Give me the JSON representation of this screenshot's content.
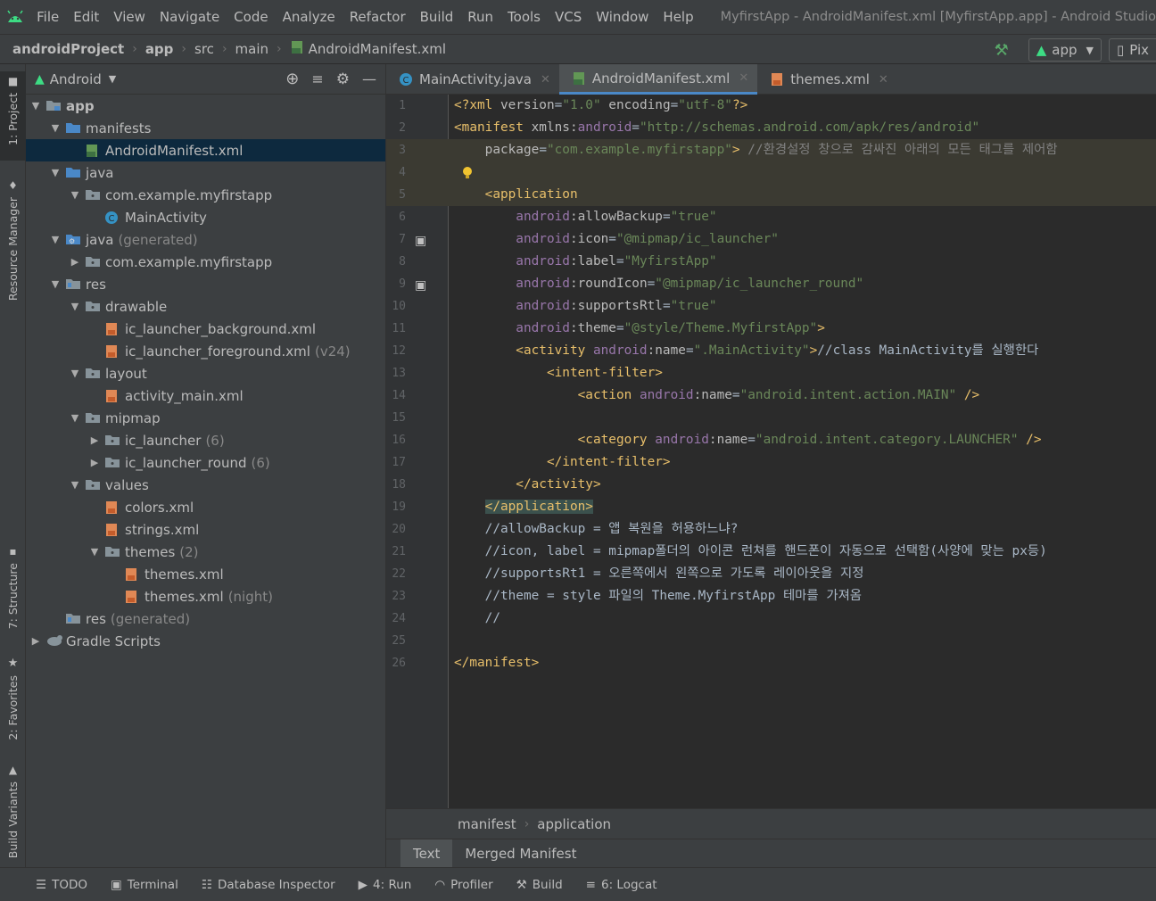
{
  "menubar": {
    "items": [
      "File",
      "Edit",
      "View",
      "Navigate",
      "Code",
      "Analyze",
      "Refactor",
      "Build",
      "Run",
      "Tools",
      "VCS",
      "Window",
      "Help"
    ],
    "window_title": "MyfirstApp - AndroidManifest.xml [MyfirstApp.app] - Android Studio"
  },
  "navbar": {
    "crumbs": [
      "androidProject",
      "app",
      "src",
      "main",
      "AndroidManifest.xml"
    ],
    "run_config": "app",
    "device": "Pix"
  },
  "side_tabs": {
    "project": "1: Project",
    "resource_manager": "Resource Manager",
    "structure": "7: Structure",
    "favorites": "2: Favorites",
    "build_variants": "Build Variants"
  },
  "project_panel": {
    "view_mode": "Android",
    "tree": [
      {
        "label": "app",
        "bold": true,
        "icon": "module-folder-icon",
        "arrow": "open",
        "depth": 0
      },
      {
        "label": "manifests",
        "icon": "folder-icon",
        "arrow": "open",
        "depth": 1
      },
      {
        "label": "AndroidManifest.xml",
        "icon": "manifest-file-icon",
        "arrow": "none",
        "depth": 2,
        "selected": true
      },
      {
        "label": "java",
        "icon": "folder-icon",
        "arrow": "open",
        "depth": 1
      },
      {
        "label": "com.example.myfirstapp",
        "icon": "package-icon",
        "arrow": "open",
        "depth": 2
      },
      {
        "label": "MainActivity",
        "icon": "class-icon",
        "arrow": "none",
        "depth": 3
      },
      {
        "label": "java",
        "suffix": "(generated)",
        "icon": "generated-folder-icon",
        "arrow": "open",
        "depth": 1
      },
      {
        "label": "com.example.myfirstapp",
        "icon": "package-icon",
        "arrow": "closed",
        "depth": 2
      },
      {
        "label": "res",
        "icon": "res-folder-icon",
        "arrow": "open",
        "depth": 1
      },
      {
        "label": "drawable",
        "icon": "package-icon",
        "arrow": "open",
        "depth": 2
      },
      {
        "label": "ic_launcher_background.xml",
        "icon": "xml-file-icon",
        "arrow": "none",
        "depth": 3
      },
      {
        "label": "ic_launcher_foreground.xml",
        "suffix": "(v24)",
        "icon": "xml-file-icon",
        "arrow": "none",
        "depth": 3
      },
      {
        "label": "layout",
        "icon": "package-icon",
        "arrow": "open",
        "depth": 2
      },
      {
        "label": "activity_main.xml",
        "icon": "xml-file-icon",
        "arrow": "none",
        "depth": 3
      },
      {
        "label": "mipmap",
        "icon": "package-icon",
        "arrow": "open",
        "depth": 2
      },
      {
        "label": "ic_launcher",
        "suffix": "(6)",
        "icon": "package-icon",
        "arrow": "closed",
        "depth": 3
      },
      {
        "label": "ic_launcher_round",
        "suffix": "(6)",
        "icon": "package-icon",
        "arrow": "closed",
        "depth": 3
      },
      {
        "label": "values",
        "icon": "package-icon",
        "arrow": "open",
        "depth": 2
      },
      {
        "label": "colors.xml",
        "icon": "xml-file-icon",
        "arrow": "none",
        "depth": 3
      },
      {
        "label": "strings.xml",
        "icon": "xml-file-icon",
        "arrow": "none",
        "depth": 3
      },
      {
        "label": "themes",
        "suffix": "(2)",
        "icon": "package-icon",
        "arrow": "open",
        "depth": 3
      },
      {
        "label": "themes.xml",
        "icon": "xml-file-icon",
        "arrow": "none",
        "depth": 4
      },
      {
        "label": "themes.xml",
        "suffix": "(night)",
        "icon": "xml-file-icon",
        "arrow": "none",
        "depth": 4
      },
      {
        "label": "res",
        "suffix": "(generated)",
        "icon": "res-folder-icon",
        "arrow": "none",
        "depth": 1
      },
      {
        "label": "Gradle Scripts",
        "icon": "gradle-icon",
        "arrow": "closed",
        "depth": 0
      }
    ]
  },
  "editor_tabs": [
    {
      "label": "MainActivity.java",
      "icon": "class-icon"
    },
    {
      "label": "AndroidManifest.xml",
      "icon": "manifest-file-icon",
      "active": true
    },
    {
      "label": "themes.xml",
      "icon": "xml-file-icon"
    }
  ],
  "code_lines": [
    [
      [
        "t",
        "<?xml "
      ],
      [
        "a",
        "version"
      ],
      [
        "p",
        "="
      ],
      [
        "s",
        "\"1.0\""
      ],
      [
        "a",
        " encoding"
      ],
      [
        "p",
        "="
      ],
      [
        "s",
        "\"utf-8\""
      ],
      [
        "t",
        "?>"
      ]
    ],
    [
      [
        "t",
        "<manifest "
      ],
      [
        "a",
        "xmlns:"
      ],
      [
        "ns",
        "android"
      ],
      [
        "p",
        "="
      ],
      [
        "s",
        "\"http://schemas.android.com/apk/res/android\""
      ]
    ],
    [
      [
        "a",
        "    package"
      ],
      [
        "p",
        "="
      ],
      [
        "s",
        "\"com.example.myfirstapp\""
      ],
      [
        "t",
        ">"
      ],
      [
        "c",
        " //환경설정 창으로 감싸진 아래의 모든 태그를 제어함"
      ]
    ],
    [
      [
        "p",
        ""
      ]
    ],
    [
      [
        "t",
        "    <application"
      ]
    ],
    [
      [
        "ns",
        "        android"
      ],
      [
        "a",
        ":allowBackup"
      ],
      [
        "p",
        "="
      ],
      [
        "s",
        "\"true\""
      ]
    ],
    [
      [
        "ns",
        "        android"
      ],
      [
        "a",
        ":icon"
      ],
      [
        "p",
        "="
      ],
      [
        "s",
        "\"@mipmap/ic_launcher\""
      ]
    ],
    [
      [
        "ns",
        "        android"
      ],
      [
        "a",
        ":label"
      ],
      [
        "p",
        "="
      ],
      [
        "s",
        "\"MyfirstApp\""
      ]
    ],
    [
      [
        "ns",
        "        android"
      ],
      [
        "a",
        ":roundIcon"
      ],
      [
        "p",
        "="
      ],
      [
        "s",
        "\"@mipmap/ic_launcher_round\""
      ]
    ],
    [
      [
        "ns",
        "        android"
      ],
      [
        "a",
        ":supportsRtl"
      ],
      [
        "p",
        "="
      ],
      [
        "s",
        "\"true\""
      ]
    ],
    [
      [
        "ns",
        "        android"
      ],
      [
        "a",
        ":theme"
      ],
      [
        "p",
        "="
      ],
      [
        "s",
        "\"@style/Theme.MyfirstApp\""
      ],
      [
        "t",
        ">"
      ]
    ],
    [
      [
        "t",
        "        <activity "
      ],
      [
        "ns",
        "android"
      ],
      [
        "a",
        ":name"
      ],
      [
        "p",
        "="
      ],
      [
        "s",
        "\".MainActivity\""
      ],
      [
        "t",
        ">"
      ],
      [
        "p",
        "//class MainActivity를 실행한다"
      ]
    ],
    [
      [
        "t",
        "            <intent-filter>"
      ]
    ],
    [
      [
        "t",
        "                <action "
      ],
      [
        "ns",
        "android"
      ],
      [
        "a",
        ":name"
      ],
      [
        "p",
        "="
      ],
      [
        "s",
        "\"android.intent.action.MAIN\""
      ],
      [
        "t",
        " />"
      ]
    ],
    [
      [
        "p",
        ""
      ]
    ],
    [
      [
        "t",
        "                <category "
      ],
      [
        "ns",
        "android"
      ],
      [
        "a",
        ":name"
      ],
      [
        "p",
        "="
      ],
      [
        "s",
        "\"android.intent.category.LAUNCHER\""
      ],
      [
        "t",
        " />"
      ]
    ],
    [
      [
        "t",
        "            </intent-filter>"
      ]
    ],
    [
      [
        "t",
        "        </activity>"
      ]
    ],
    [
      [
        "p",
        "    "
      ],
      [
        "t",
        "</application>"
      ]
    ],
    [
      [
        "p",
        "    //allowBackup = 앱 복원을 허용하느냐?"
      ]
    ],
    [
      [
        "p",
        "    //icon, label = mipmap폴더의 아이콘 런쳐를 핸드폰이 자동으로 선택함(사양에 맞는 px등)"
      ]
    ],
    [
      [
        "p",
        "    //supportsRt1 = 오른쪽에서 왼쪽으로 가도록 레이아웃을 지정"
      ]
    ],
    [
      [
        "p",
        "    //theme = style 파일의 Theme.MyfirstApp 테마를 가져옴"
      ]
    ],
    [
      [
        "p",
        "    //"
      ]
    ],
    [
      [
        "p",
        ""
      ]
    ],
    [
      [
        "t",
        "</manifest>"
      ]
    ]
  ],
  "editor_breadcrumb": [
    "manifest",
    "application"
  ],
  "editor_bottom_tabs": [
    {
      "label": "Text",
      "active": true
    },
    {
      "label": "Merged Manifest"
    }
  ],
  "statusbar": [
    {
      "label": "TODO",
      "icon": "list-icon"
    },
    {
      "label": "Terminal",
      "icon": "terminal-icon"
    },
    {
      "label": "Database Inspector",
      "icon": "database-icon"
    },
    {
      "label": "4: Run",
      "icon": "run-icon"
    },
    {
      "label": "Profiler",
      "icon": "profiler-icon"
    },
    {
      "label": "Build",
      "icon": "hammer-icon"
    },
    {
      "label": "6: Logcat",
      "icon": "logcat-icon"
    }
  ],
  "colors": {
    "tag": "#e8bf6a",
    "attr": "#bababa",
    "namespace": "#9876aa",
    "string": "#6a8759",
    "comment": "#808080",
    "selection": "#0d293e",
    "accent": "#4a88c7"
  }
}
